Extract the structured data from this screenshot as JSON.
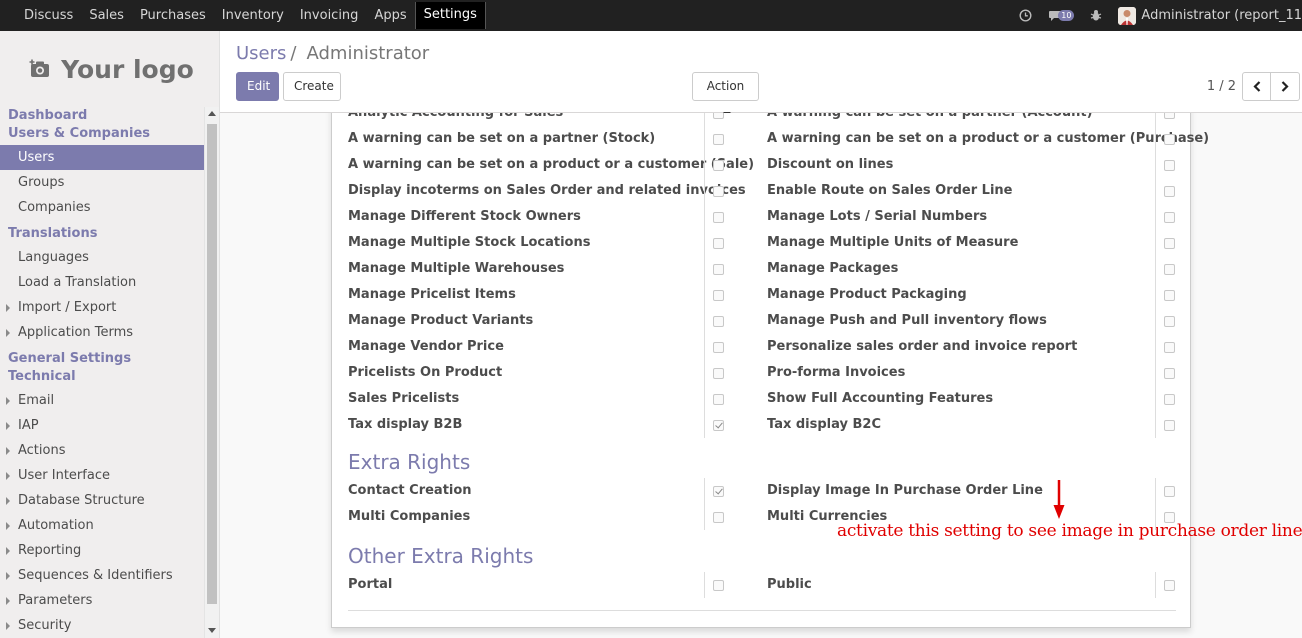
{
  "topbar": {
    "menu": [
      "Discuss",
      "Sales",
      "Purchases",
      "Inventory",
      "Invoicing",
      "Apps",
      "Settings"
    ],
    "active": "Settings",
    "messages_count": "10",
    "user": "Administrator (report_11"
  },
  "sidebar": {
    "logo_text": "Your logo",
    "items": [
      {
        "label": "Dashboard",
        "kind": "head"
      },
      {
        "label": "Users & Companies",
        "kind": "head"
      },
      {
        "label": "Users",
        "kind": "item",
        "active": true
      },
      {
        "label": "Groups",
        "kind": "item"
      },
      {
        "label": "Companies",
        "kind": "item"
      },
      {
        "label": "Translations",
        "kind": "head"
      },
      {
        "label": "Languages",
        "kind": "item"
      },
      {
        "label": "Load a Translation",
        "kind": "item"
      },
      {
        "label": "Import / Export",
        "kind": "tree"
      },
      {
        "label": "Application Terms",
        "kind": "tree"
      },
      {
        "label": "General Settings",
        "kind": "head"
      },
      {
        "label": "Technical",
        "kind": "head"
      },
      {
        "label": "Email",
        "kind": "tree"
      },
      {
        "label": "IAP",
        "kind": "tree"
      },
      {
        "label": "Actions",
        "kind": "tree"
      },
      {
        "label": "User Interface",
        "kind": "tree"
      },
      {
        "label": "Database Structure",
        "kind": "tree"
      },
      {
        "label": "Automation",
        "kind": "tree"
      },
      {
        "label": "Reporting",
        "kind": "tree"
      },
      {
        "label": "Sequences & Identifiers",
        "kind": "tree"
      },
      {
        "label": "Parameters",
        "kind": "tree"
      },
      {
        "label": "Security",
        "kind": "tree"
      }
    ]
  },
  "control_panel": {
    "breadcrumb_parent": "Users",
    "breadcrumb_sep": "/",
    "breadcrumb_current": "Administrator",
    "edit_label": "Edit",
    "create_label": "Create",
    "action_label": "Action",
    "pager": "1 / 2"
  },
  "rights": [
    {
      "left": "Analytic Accounting for Sales",
      "left_checked": false,
      "right": "A warning can be set on a partner (Account)",
      "right_checked": false
    },
    {
      "left": "A warning can be set on a partner (Stock)",
      "left_checked": false,
      "right": "A warning can be set on a product or a customer (Purchase)",
      "right_checked": false
    },
    {
      "left": "A warning can be set on a product or a customer (Sale)",
      "left_checked": false,
      "right": "Discount on lines",
      "right_checked": false
    },
    {
      "left": "Display incoterms on Sales Order and related invoices",
      "left_checked": false,
      "right": "Enable Route on Sales Order Line",
      "right_checked": false
    },
    {
      "left": "Manage Different Stock Owners",
      "left_checked": false,
      "right": "Manage Lots / Serial Numbers",
      "right_checked": false
    },
    {
      "left": "Manage Multiple Stock Locations",
      "left_checked": false,
      "right": "Manage Multiple Units of Measure",
      "right_checked": false
    },
    {
      "left": "Manage Multiple Warehouses",
      "left_checked": false,
      "right": "Manage Packages",
      "right_checked": false
    },
    {
      "left": "Manage Pricelist Items",
      "left_checked": false,
      "right": "Manage Product Packaging",
      "right_checked": false
    },
    {
      "left": "Manage Product Variants",
      "left_checked": false,
      "right": "Manage Push and Pull inventory flows",
      "right_checked": false
    },
    {
      "left": "Manage Vendor Price",
      "left_checked": false,
      "right": "Personalize sales order and invoice report",
      "right_checked": false
    },
    {
      "left": "Pricelists On Product",
      "left_checked": false,
      "right": "Pro-forma Invoices",
      "right_checked": false
    },
    {
      "left": "Sales Pricelists",
      "left_checked": false,
      "right": "Show Full Accounting Features",
      "right_checked": false
    },
    {
      "left": "Tax display B2B",
      "left_checked": true,
      "right": "Tax display B2C",
      "right_checked": false
    }
  ],
  "extra_rights": {
    "title": "Extra Rights",
    "rows": [
      {
        "left": "Contact Creation",
        "left_checked": true,
        "right": "Display Image In Purchase Order Line",
        "right_checked": false
      },
      {
        "left": "Multi Companies",
        "left_checked": false,
        "right": "Multi Currencies",
        "right_checked": false
      }
    ]
  },
  "other_extra_rights": {
    "title": "Other Extra Rights",
    "rows": [
      {
        "left": "Portal",
        "left_checked": false,
        "right": "Public",
        "right_checked": false
      }
    ]
  },
  "annotation": "activate this setting to see image in purchase order line",
  "colors": {
    "accent": "#7c7bad",
    "topbar": "#212121",
    "annotation": "#e00000"
  }
}
